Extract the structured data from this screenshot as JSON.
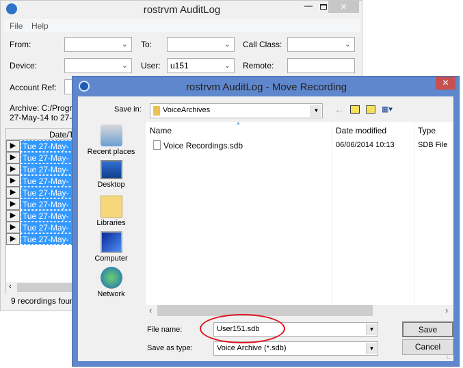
{
  "main": {
    "title": "rostrvm AuditLog",
    "menu": [
      "File",
      "Help"
    ],
    "filters": {
      "from_label": "From:",
      "from_value": "",
      "to_label": "To:",
      "to_value": "",
      "call_class_label": "Call Class:",
      "call_class_value": "",
      "device_label": "Device:",
      "device_value": "",
      "user_label": "User:",
      "user_value": "u151",
      "remote_label": "Remote:",
      "remote_value": "",
      "account_ref_label": "Account Ref:",
      "account_ref_value": ""
    },
    "archive_line1": "Archive: C:/Progr",
    "archive_line2": "27-May-14 to 27-",
    "grid": {
      "header": "Date/T",
      "rows": [
        "Tue 27-May-14",
        "Tue 27-May-14",
        "Tue 27-May-14",
        "Tue 27-May-14",
        "Tue 27-May-14",
        "Tue 27-May-14",
        "Tue 27-May-14",
        "Tue 27-May-14",
        "Tue 27-May-14"
      ],
      "selection_color": "#3399ff"
    },
    "status": "9 recordings foun"
  },
  "dialog": {
    "title": "rostrvm AuditLog - Move Recording",
    "save_in_label": "Save in:",
    "save_in_value": "VoiceArchives",
    "places": [
      "Recent places",
      "Desktop",
      "Libraries",
      "Computer",
      "Network"
    ],
    "columns": [
      "Name",
      "Date modified",
      "Type"
    ],
    "files": [
      {
        "name": "Voice Recordings.sdb",
        "date": "06/06/2014 10:13",
        "type": "SDB File"
      }
    ],
    "file_name_label": "File name:",
    "file_name_value": "User151.sdb",
    "save_as_type_label": "Save as type:",
    "save_as_type_value": "Voice Archive (*.sdb)",
    "save_label": "Save",
    "cancel_label": "Cancel",
    "title_color": "#5f87cd",
    "annotation_color": "#e0141e"
  }
}
